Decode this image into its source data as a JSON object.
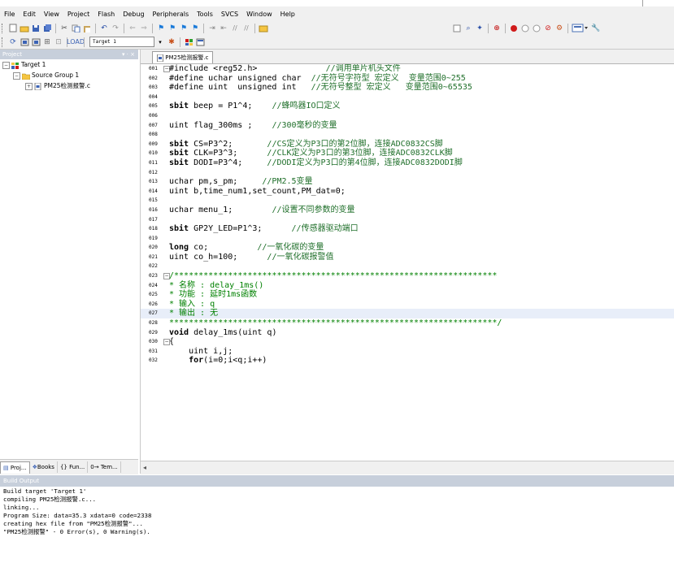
{
  "menu": [
    "File",
    "Edit",
    "View",
    "Project",
    "Flash",
    "Debug",
    "Peripherals",
    "Tools",
    "SVCS",
    "Window",
    "Help"
  ],
  "toolbar": {
    "target_select": "Target 1"
  },
  "project_panel": {
    "title": "Project",
    "controls": "▾ · ×",
    "tree": {
      "target": "Target 1",
      "group": "Source Group 1",
      "file": "PM25检测报警.c"
    },
    "tabs": [
      "Proj...",
      "Books",
      "{} Fun...",
      "0→ Tem..."
    ]
  },
  "editor": {
    "tab_label": "PM25检测报警.c",
    "lines": [
      {
        "n": "001",
        "t": "#include <reg52.h>              //调用单片机头文件",
        "fold": "-"
      },
      {
        "n": "002",
        "t": "#define uchar unsigned char  //无符号字符型 宏定义  变量范围0~255"
      },
      {
        "n": "003",
        "t": "#define uint  unsigned int   //无符号整型 宏定义   变量范围0~65535"
      },
      {
        "n": "004",
        "t": ""
      },
      {
        "n": "005",
        "t": "sbit beep = P1^4;    //蜂鸣器IO口定义",
        "kw": "sbit"
      },
      {
        "n": "006",
        "t": ""
      },
      {
        "n": "007",
        "t": "uint flag_300ms ;    //300毫秒的变量"
      },
      {
        "n": "008",
        "t": ""
      },
      {
        "n": "009",
        "t": "sbit CS=P3^2;       //CS定义为P3口的第2位脚，连接ADC0832CS脚",
        "kw": "sbit"
      },
      {
        "n": "010",
        "t": "sbit CLK=P3^3;      //CLK定义为P3口的第3位脚，连接ADC0832CLK脚",
        "kw": "sbit"
      },
      {
        "n": "011",
        "t": "sbit DODI=P3^4;     //DODI定义为P3口的第4位脚，连接ADC0832DODI脚",
        "kw": "sbit"
      },
      {
        "n": "012",
        "t": ""
      },
      {
        "n": "013",
        "t": "uchar pm,s_pm;     //PM2.5变量"
      },
      {
        "n": "014",
        "t": "uint b,time_num1,set_count,PM_dat=0;"
      },
      {
        "n": "015",
        "t": ""
      },
      {
        "n": "016",
        "t": "uchar menu_1;        //设置不同参数的变量"
      },
      {
        "n": "017",
        "t": ""
      },
      {
        "n": "018",
        "t": "sbit GP2Y_LED=P1^3;      //传感器驱动端口",
        "kw": "sbit"
      },
      {
        "n": "019",
        "t": ""
      },
      {
        "n": "020",
        "t": "long co;          //一氧化碳的变量",
        "kw": "long"
      },
      {
        "n": "021",
        "t": "uint co_h=100;      //一氧化碳报警值"
      },
      {
        "n": "022",
        "t": ""
      },
      {
        "n": "023",
        "t": "/******************************************************************",
        "cmt": true,
        "fold": "-"
      },
      {
        "n": "024",
        "t": "* 名称 : delay_1ms()",
        "cmt": true
      },
      {
        "n": "025",
        "t": "* 功能 : 延时1ms函数",
        "cmt": true
      },
      {
        "n": "026",
        "t": "* 输入 : q",
        "cmt": true
      },
      {
        "n": "027",
        "t": "* 输出 : 无",
        "cmt": true,
        "hl": true
      },
      {
        "n": "028",
        "t": "*******************************************************************/",
        "cmt": true
      },
      {
        "n": "029",
        "t": "void delay_1ms(uint q)",
        "kw": "void"
      },
      {
        "n": "030",
        "t": "{",
        "fold": "-"
      },
      {
        "n": "031",
        "t": "    uint i,j;"
      },
      {
        "n": "032",
        "t": "    for(i=0;i<q;i++)",
        "kw": "for"
      }
    ]
  },
  "build_output": {
    "title": "Build Output",
    "lines": [
      "Build target 'Target 1'",
      "compiling PM25检测报警.c...",
      "linking...",
      "Program Size: data=35.3 xdata=0 code=2338",
      "creating hex file from \"PM25检测报警\"...",
      "\"PM25检测报警\" - 0 Error(s), 0 Warning(s)."
    ]
  },
  "colors": {
    "panel_header": "#c7cfdb",
    "comment": "#008000",
    "highlight": "#e8eef9"
  }
}
